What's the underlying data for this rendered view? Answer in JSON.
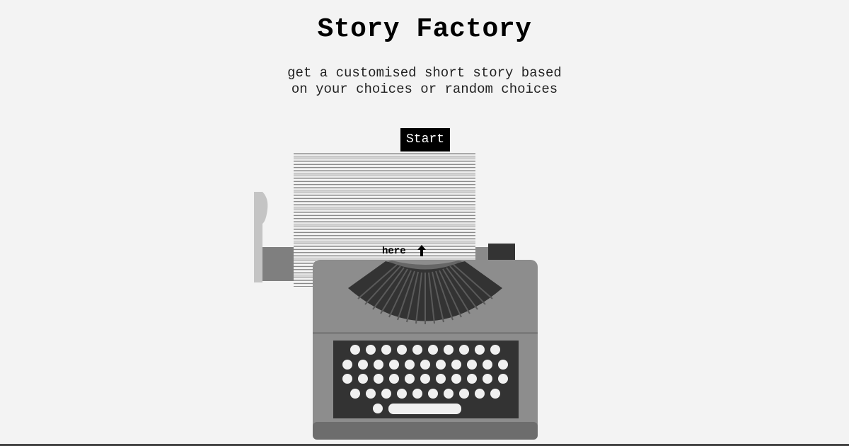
{
  "header": {
    "title": "Story Factory",
    "subtitle": "get a customised short story based on your choices or random choices"
  },
  "actions": {
    "start_label": "Start"
  },
  "paper": {
    "hint_label": "here"
  },
  "icons": {
    "hint_arrow": "arrow-up-icon"
  },
  "colors": {
    "background": "#f3f3f3",
    "button_bg": "#000000",
    "button_text": "#ffffff",
    "typewriter_body": "#8a8a8a",
    "keyboard_panel": "#333333",
    "keys": "#f0f0f0"
  }
}
